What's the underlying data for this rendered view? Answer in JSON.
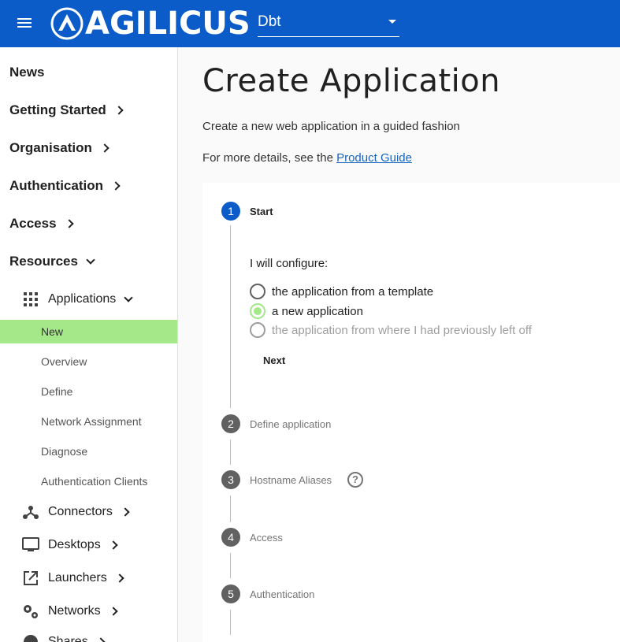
{
  "topbar": {
    "logo_text": "AGILICUS",
    "org_value": "Dbt",
    "bg_color": "#0b5cc9"
  },
  "sidebar": {
    "top_items": [
      {
        "label": "News"
      },
      {
        "label": "Getting Started"
      },
      {
        "label": "Organisation"
      },
      {
        "label": "Authentication"
      },
      {
        "label": "Access"
      },
      {
        "label": "Resources"
      }
    ],
    "applications": {
      "label": "Applications",
      "icon": "apps-grid-icon"
    },
    "app_children": [
      {
        "label": "New",
        "active": true
      },
      {
        "label": "Overview"
      },
      {
        "label": "Define"
      },
      {
        "label": "Network Assignment"
      },
      {
        "label": "Diagnose"
      },
      {
        "label": "Authentication Clients"
      }
    ],
    "sub_items": [
      {
        "label": "Connectors",
        "icon": "connectors-icon"
      },
      {
        "label": "Desktops",
        "icon": "desktop-icon"
      },
      {
        "label": "Launchers",
        "icon": "launch-icon"
      },
      {
        "label": "Networks",
        "icon": "network-gears-icon"
      },
      {
        "label": "Shares",
        "icon": "share-icon"
      }
    ],
    "active_color": "#a5e88a"
  },
  "main": {
    "title": "Create Application",
    "description": "Create a new web application in a guided fashion",
    "details_prefix": "For more details, see the ",
    "details_link": "Product Guide",
    "steps": [
      {
        "num": "1",
        "label": "Start",
        "active": true
      },
      {
        "num": "2",
        "label": "Define application"
      },
      {
        "num": "3",
        "label": "Hostname Aliases"
      },
      {
        "num": "4",
        "label": "Access"
      },
      {
        "num": "5",
        "label": "Authentication"
      }
    ],
    "configure_label": "I will configure:",
    "options": [
      {
        "label": "the application from a template",
        "checked": false,
        "disabled": false
      },
      {
        "label": "a new application",
        "checked": true,
        "disabled": false
      },
      {
        "label": "the application from where I had previously left off",
        "checked": false,
        "disabled": true
      }
    ],
    "next_label": "Next",
    "help_glyph": "?"
  }
}
